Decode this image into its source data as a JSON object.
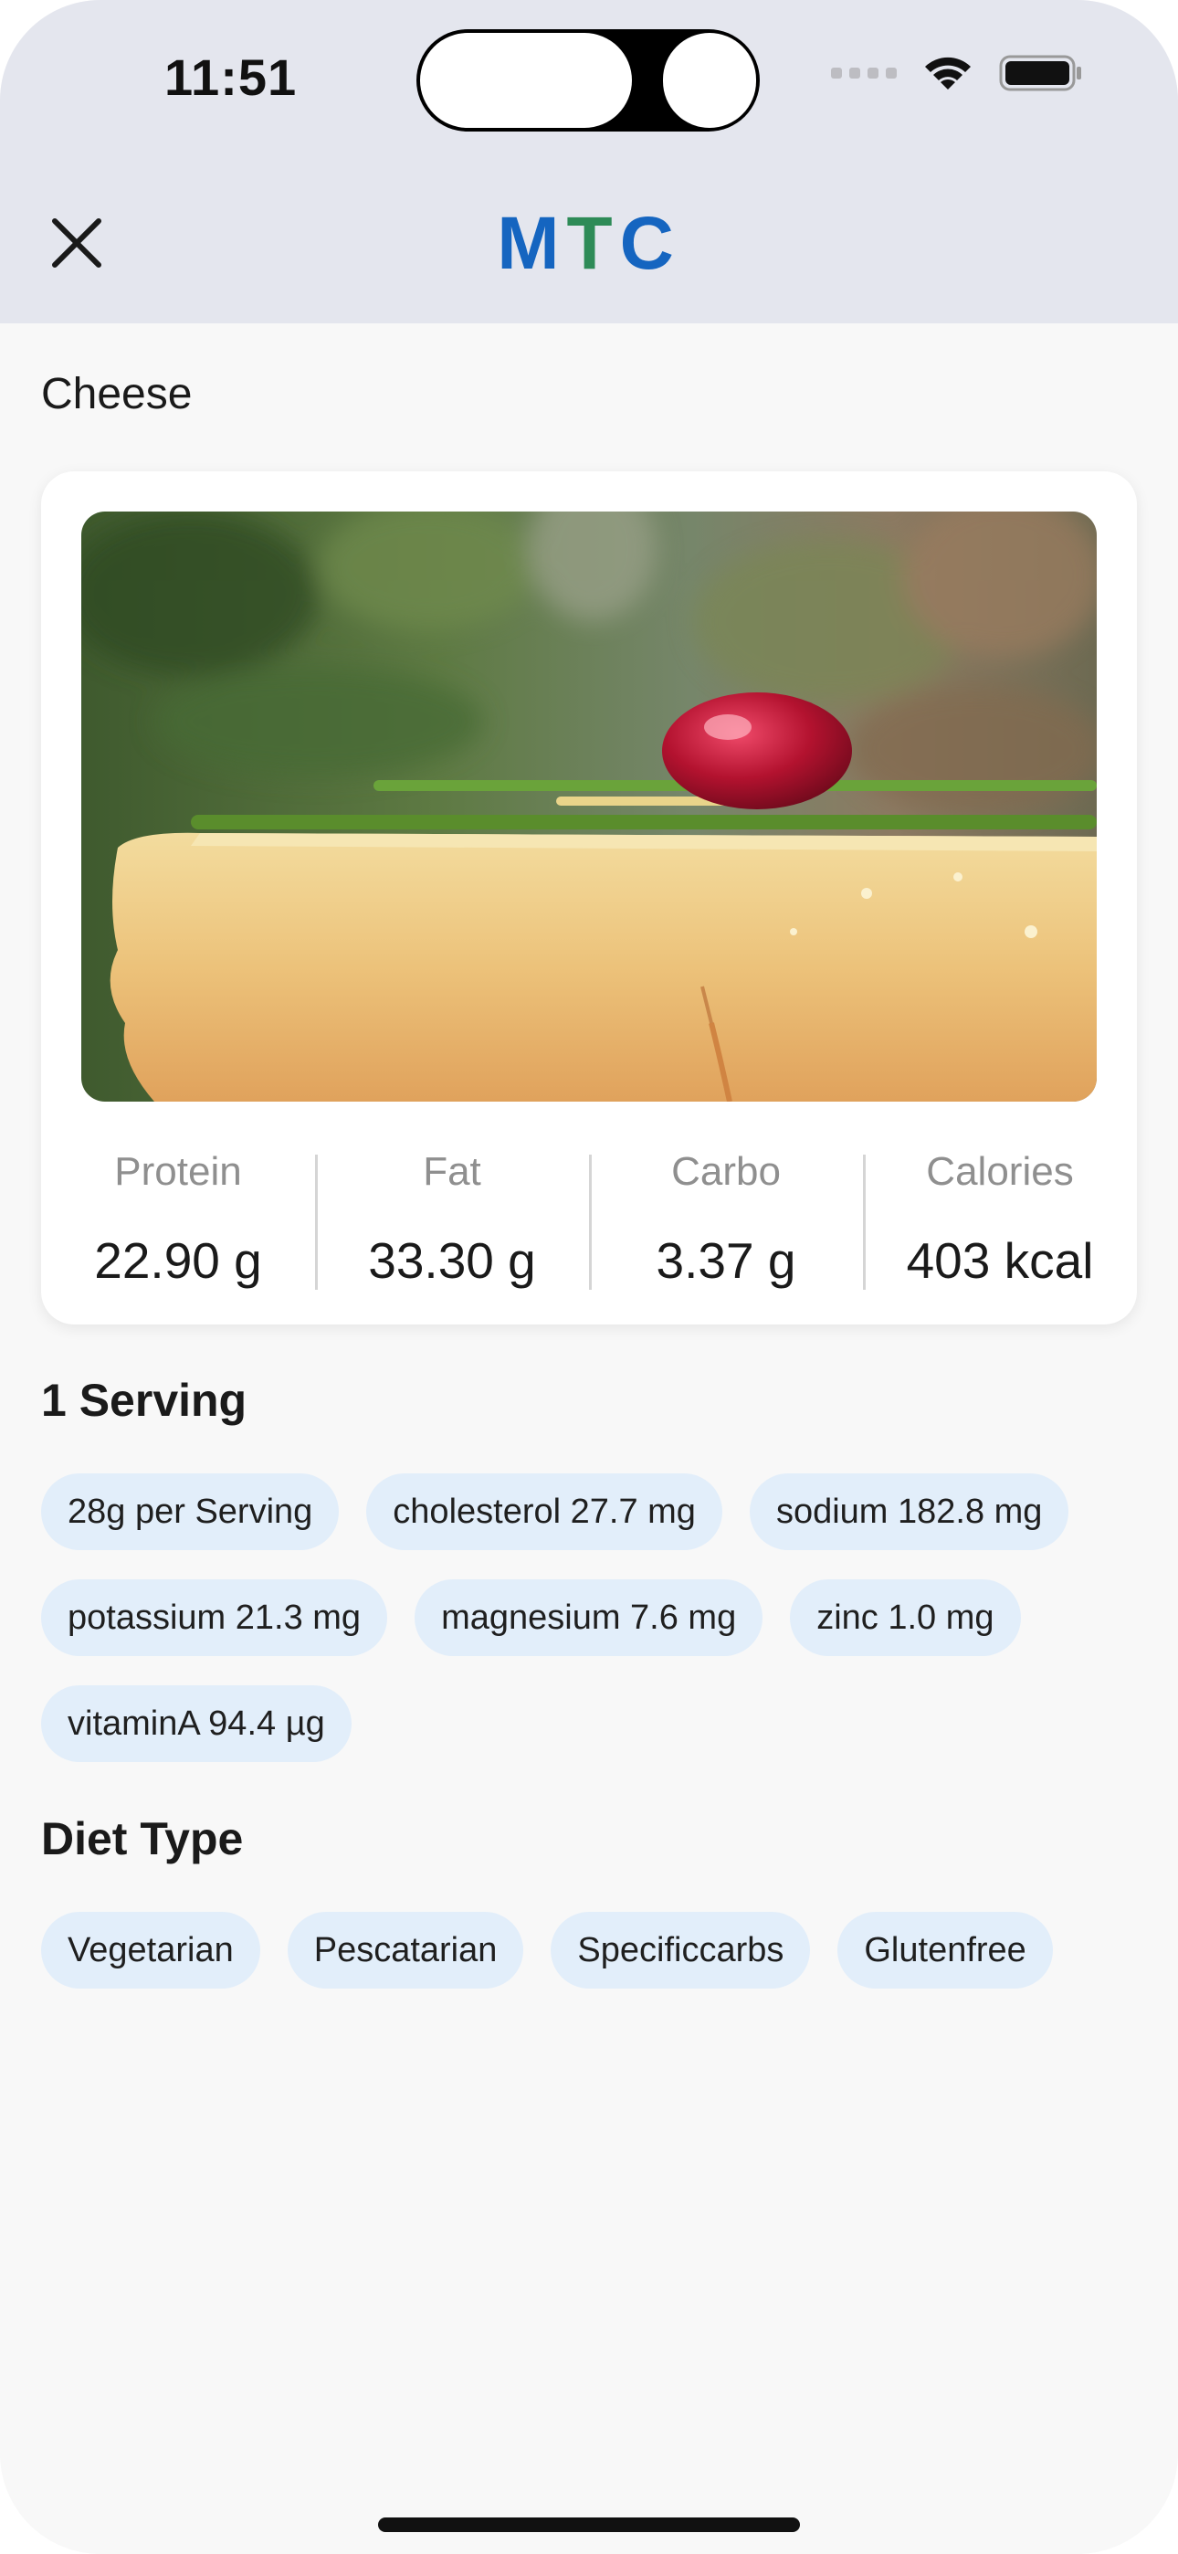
{
  "status_bar": {
    "time": "11:51"
  },
  "header": {
    "logo_m": "M",
    "logo_t": "T",
    "logo_c": "C",
    "close_icon": "close-icon"
  },
  "food": {
    "name": "Cheese"
  },
  "macros": [
    {
      "label": "Protein",
      "value": "22.90 g"
    },
    {
      "label": "Fat",
      "value": "33.30 g"
    },
    {
      "label": "Carbo",
      "value": "3.37 g"
    },
    {
      "label": "Calories",
      "value": "403 kcal"
    }
  ],
  "serving": {
    "title": "1 Serving",
    "chips": [
      "28g per Serving",
      "cholesterol 27.7 mg",
      "sodium 182.8 mg",
      "potassium 21.3 mg",
      "magnesium 7.6 mg",
      "zinc 1.0 mg",
      "vitaminA 94.4 µg"
    ]
  },
  "diet": {
    "title": "Diet Type",
    "chips": [
      "Vegetarian",
      "Pescatarian",
      "Specificcarbs",
      "Glutenfree"
    ]
  },
  "colors": {
    "logo_blue": "#1565c0",
    "logo_green": "#2e8b57",
    "chip_bg": "#e2eefa",
    "header_bg": "#e4e6ee"
  }
}
